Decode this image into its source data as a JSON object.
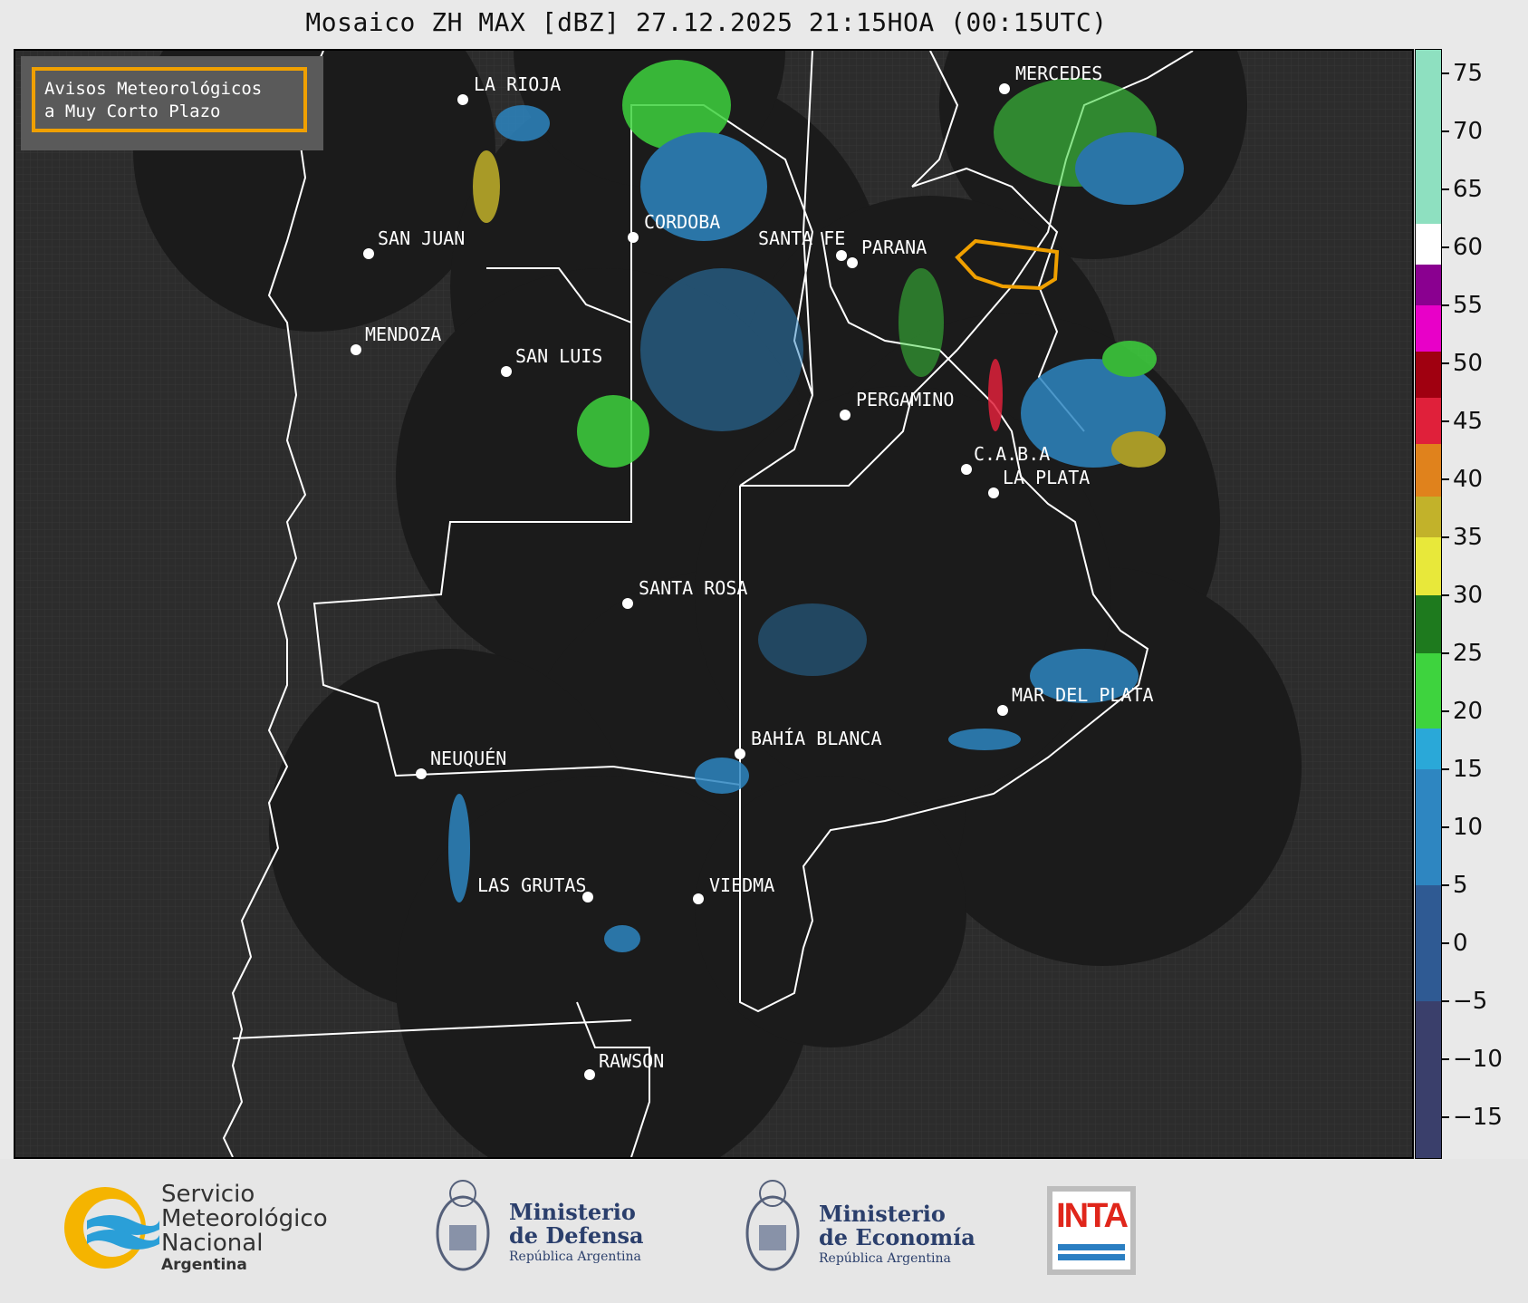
{
  "title": "Mosaico ZH MAX [dBZ] 27.12.2025 21:15HOA (00:15UTC)",
  "legend_box": {
    "line1": "Avisos Meteorológicos",
    "line2": "a Muy Corto Plazo"
  },
  "cities": [
    {
      "name": "LA RIOJA"
    },
    {
      "name": "MERCEDES"
    },
    {
      "name": "CORDOBA"
    },
    {
      "name": "SAN JUAN"
    },
    {
      "name": "SANTA FE"
    },
    {
      "name": "PARANA"
    },
    {
      "name": "MENDOZA"
    },
    {
      "name": "SAN LUIS"
    },
    {
      "name": "PERGAMINO"
    },
    {
      "name": "C.A.B.A"
    },
    {
      "name": "LA PLATA"
    },
    {
      "name": "SANTA ROSA"
    },
    {
      "name": "MAR DEL PLATA"
    },
    {
      "name": "BAHÍA BLANCA"
    },
    {
      "name": "NEUQUÉN"
    },
    {
      "name": "LAS GRUTAS"
    },
    {
      "name": "VIEDMA"
    },
    {
      "name": "RAWSON"
    }
  ],
  "colorbar": {
    "unit": "dBZ",
    "ticks": [
      "75",
      "70",
      "65",
      "60",
      "55",
      "50",
      "45",
      "40",
      "35",
      "30",
      "25",
      "20",
      "15",
      "10",
      "5",
      "0",
      "−5",
      "−10",
      "−15"
    ],
    "colors": {
      "c_neg": "#3a3f6b",
      "c_low": "#2f5a93",
      "c_blue": "#2e86c1",
      "c_cyan": "#2aa8d8",
      "c_green_lo": "#3ed33e",
      "c_green_hi": "#1e7a1e",
      "c_yellow": "#e8e83a",
      "c_olive": "#c2b22a",
      "c_orange": "#e0821c",
      "c_red": "#e0203a",
      "c_darkred": "#a00010",
      "c_magenta": "#e800c8",
      "c_purple": "#8a0090",
      "c_white": "#ffffff",
      "c_mint": "#8ee0c0"
    }
  },
  "footer": {
    "smn_line1": "Servicio",
    "smn_line2": "Meteorológico",
    "smn_line3": "Nacional",
    "smn_line4": "Argentina",
    "defensa_line1": "Ministerio",
    "defensa_line2": "de Defensa",
    "defensa_line3": "República Argentina",
    "economia_line1": "Ministerio",
    "economia_line2": "de Economía",
    "economia_line3": "República Argentina",
    "inta": "INTA"
  }
}
